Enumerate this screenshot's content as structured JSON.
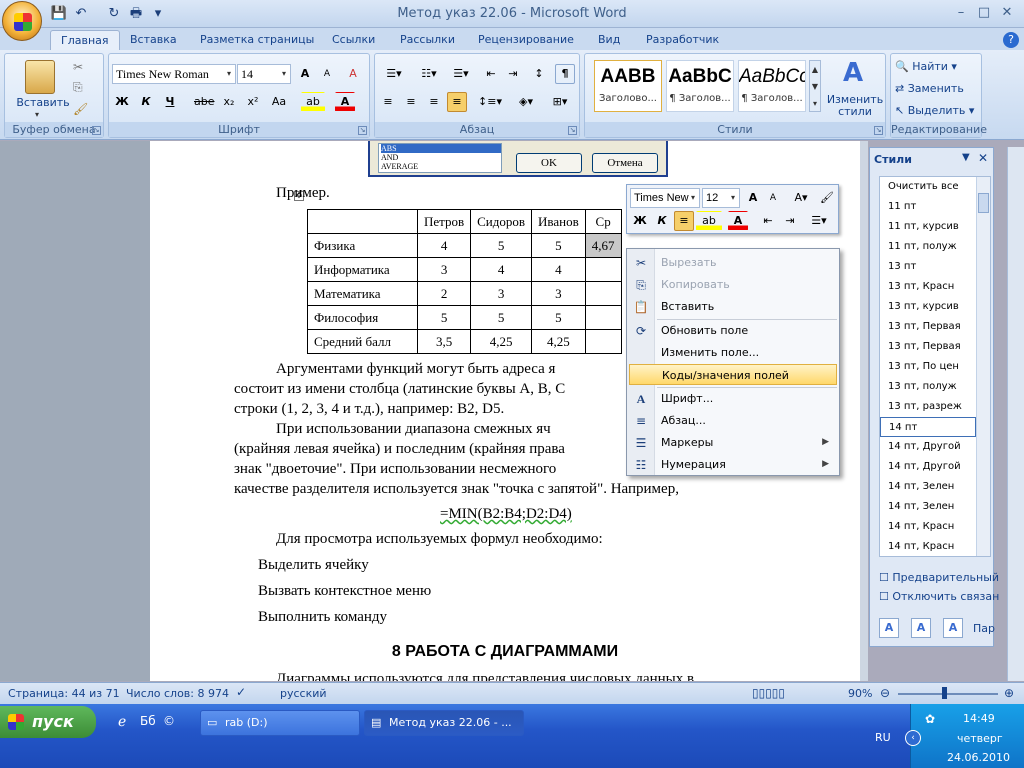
{
  "window": {
    "title": "Метод указ 22.06 - Microsoft Word",
    "min": "–",
    "max": "□",
    "close": "✕"
  },
  "qat": {
    "save": "💾",
    "undo": "↶",
    "redo": "↻",
    "print": "🖶",
    "more": "▾"
  },
  "tabs": [
    "Главная",
    "Вставка",
    "Разметка страницы",
    "Ссылки",
    "Рассылки",
    "Рецензирование",
    "Вид",
    "Разработчик"
  ],
  "ribbon": {
    "clipboard": {
      "label": "Буфер обмена",
      "paste": "Вставить"
    },
    "font": {
      "label": "Шрифт",
      "name": "Times New Roman",
      "size": "14",
      "bold": "Ж",
      "italic": "К",
      "underline": "Ч",
      "strike": "abe",
      "sub": "x₂",
      "sup": "x²",
      "case": "Aa",
      "grow": "A",
      "shrink": "A",
      "clear": "A"
    },
    "paragraph": {
      "label": "Абзац",
      "pilcrow": "¶"
    },
    "styles": {
      "label": "Стили",
      "items": [
        {
          "preview": "AABB",
          "name": "Заголово..."
        },
        {
          "preview": "AaBbC",
          "name": "¶ Заголов..."
        },
        {
          "preview": "AaBbCc",
          "name": "¶ Заголов..."
        }
      ],
      "change": "Изменить стили"
    },
    "editing": {
      "label": "Редактирование",
      "find": "Найти",
      "replace": "Заменить",
      "select": "Выделить"
    }
  },
  "dialog_fragment": {
    "items": [
      "ABS",
      "AND",
      "AVERAGE"
    ],
    "ok": "OK",
    "cancel": "Отмена"
  },
  "document": {
    "example_label": "Пример.",
    "table": {
      "headers": [
        "",
        "Петров",
        "Сидоров",
        "Иванов",
        "Ср"
      ],
      "rows": [
        [
          "Физика",
          "4",
          "5",
          "5",
          "4,67"
        ],
        [
          "Информатика",
          "3",
          "4",
          "4",
          ""
        ],
        [
          "Математика",
          "2",
          "3",
          "3",
          ""
        ],
        [
          "Философия",
          "5",
          "5",
          "5",
          ""
        ],
        [
          "Средний балл",
          "3,5",
          "4,25",
          "4,25",
          ""
        ]
      ]
    },
    "para1_l1": "Аргументами функций могут быть адреса я",
    "para1_l2": "состоит из имени столбца (латинские буквы A, B, C",
    "para1_l3": "строки (1, 2, 3, 4 и т.д.), например: B2, D5.",
    "para2_l1": "При использовании диапазона смежных яч",
    "para2_l2": "(крайняя левая ячейка) и последним (крайняя права",
    "para2_l3": "знак \"двоеточие\". При использовании несмежного",
    "para2_l4": "качестве разделителя используется знак \"точка с запятой\". Например,",
    "formula": "=MIN(B2:B4;D2:D4)",
    "para3": "Для просмотра используемых формул необходимо:",
    "step1": "Выделить ячейку",
    "step2": "Вызвать контекстное меню",
    "step3": "Выполнить команду",
    "heading": "8 РАБОТА С ДИАГРАММАМИ",
    "para4_partial": "Диаграммы используются для представления числовых данных в"
  },
  "mini_toolbar": {
    "font": "Times New",
    "size": "12",
    "bold": "Ж",
    "italic": "К"
  },
  "context_menu": {
    "items": [
      {
        "label": "Вырезать",
        "icon": "✂",
        "disabled": true
      },
      {
        "label": "Копировать",
        "icon": "⎘",
        "disabled": true
      },
      {
        "label": "Вставить",
        "icon": "📋",
        "disabled": false
      },
      {
        "label": "Обновить поле",
        "icon": "⟳",
        "disabled": false
      },
      {
        "label": "Изменить поле...",
        "icon": "",
        "disabled": false
      },
      {
        "label": "Коды/значения полей",
        "icon": "",
        "disabled": false,
        "highlighted": true
      },
      {
        "label": "Шрифт...",
        "icon": "A",
        "disabled": false
      },
      {
        "label": "Абзац...",
        "icon": "≡",
        "disabled": false
      },
      {
        "label": "Маркеры",
        "icon": "☰",
        "disabled": false,
        "submenu": true
      },
      {
        "label": "Нумерация",
        "icon": "☷",
        "disabled": false,
        "submenu": true
      }
    ]
  },
  "styles_pane": {
    "title": "Стили",
    "items": [
      "Очистить все",
      "11 пт",
      "11 пт, курсив",
      "11 пт, полуж",
      "13 пт",
      "13 пт, Красн",
      "13 пт, курсив",
      "13 пт, Первая",
      "13 пт, Первая",
      "13 пт, По цен",
      "13 пт, полуж",
      "13 пт, разреж",
      "14 пт",
      "14 пт, Другой",
      "14 пт, Другой",
      "14 пт, Зелен",
      "14 пт, Зелен",
      "14 пт, Красн",
      "14 пт, Красн"
    ],
    "selected": "14 пт",
    "preview_label": "Предварительный",
    "linked_label": "Отключить связан",
    "params_label": "Пар"
  },
  "status": {
    "page": "Страница: 44 из 71",
    "words": "Число слов: 8 974",
    "language": "русский",
    "zoom": "90%"
  },
  "taskbar": {
    "start": "пуск",
    "tasks": [
      "rab (D:)",
      "Метод указ 22.06 - ..."
    ],
    "lang": "RU",
    "time": "14:49",
    "day": "четверг",
    "date": "24.06.2010"
  }
}
